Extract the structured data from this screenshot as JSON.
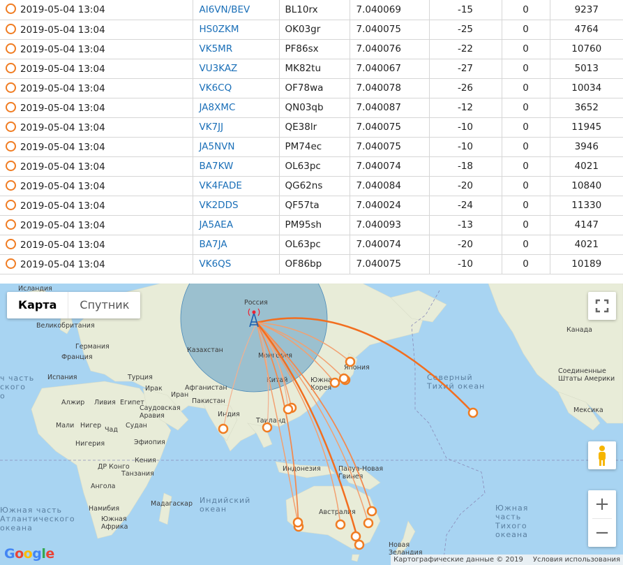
{
  "spots": [
    {
      "time": "2019-05-04 13:04",
      "call": "AI6VN/BEV",
      "grid": "BL10rx",
      "freq": "7.040069",
      "snr": "-15",
      "drift": "0",
      "dist": "9237"
    },
    {
      "time": "2019-05-04 13:04",
      "call": "HS0ZKM",
      "grid": "OK03gr",
      "freq": "7.040075",
      "snr": "-25",
      "drift": "0",
      "dist": "4764"
    },
    {
      "time": "2019-05-04 13:04",
      "call": "VK5MR",
      "grid": "PF86sx",
      "freq": "7.040076",
      "snr": "-22",
      "drift": "0",
      "dist": "10760"
    },
    {
      "time": "2019-05-04 13:04",
      "call": "VU3KAZ",
      "grid": "MK82tu",
      "freq": "7.040067",
      "snr": "-27",
      "drift": "0",
      "dist": "5013"
    },
    {
      "time": "2019-05-04 13:04",
      "call": "VK6CQ",
      "grid": "OF78wa",
      "freq": "7.040078",
      "snr": "-26",
      "drift": "0",
      "dist": "10034"
    },
    {
      "time": "2019-05-04 13:04",
      "call": "JA8XMC",
      "grid": "QN03qb",
      "freq": "7.040087",
      "snr": "-12",
      "drift": "0",
      "dist": "3652"
    },
    {
      "time": "2019-05-04 13:04",
      "call": "VK7JJ",
      "grid": "QE38lr",
      "freq": "7.040075",
      "snr": "-10",
      "drift": "0",
      "dist": "11945"
    },
    {
      "time": "2019-05-04 13:04",
      "call": "JA5NVN",
      "grid": "PM74ec",
      "freq": "7.040075",
      "snr": "-10",
      "drift": "0",
      "dist": "3946"
    },
    {
      "time": "2019-05-04 13:04",
      "call": "BA7KW",
      "grid": "OL63pc",
      "freq": "7.040074",
      "snr": "-18",
      "drift": "0",
      "dist": "4021"
    },
    {
      "time": "2019-05-04 13:04",
      "call": "VK4FADE",
      "grid": "QG62ns",
      "freq": "7.040084",
      "snr": "-20",
      "drift": "0",
      "dist": "10840"
    },
    {
      "time": "2019-05-04 13:04",
      "call": "VK2DDS",
      "grid": "QF57ta",
      "freq": "7.040024",
      "snr": "-24",
      "drift": "0",
      "dist": "11330"
    },
    {
      "time": "2019-05-04 13:04",
      "call": "JA5AEA",
      "grid": "PM95sh",
      "freq": "7.040093",
      "snr": "-13",
      "drift": "0",
      "dist": "4147"
    },
    {
      "time": "2019-05-04 13:04",
      "call": "BA7JA",
      "grid": "OL63pc",
      "freq": "7.040074",
      "snr": "-20",
      "drift": "0",
      "dist": "4021"
    },
    {
      "time": "2019-05-04 13:04",
      "call": "VK6QS",
      "grid": "OF86bp",
      "freq": "7.040075",
      "snr": "-10",
      "drift": "0",
      "dist": "10189"
    }
  ],
  "map": {
    "maptype": {
      "map": "Карта",
      "satellite": "Спутник"
    },
    "zoom": {
      "in": "+",
      "out": "−"
    },
    "google": "Google",
    "attribution": {
      "data": "Картографические данные © 2019",
      "terms": "Условия использования"
    },
    "labels": {
      "iceland": "Исландия",
      "russia": "Россия",
      "uk": "Великобритания",
      "germany": "Германия",
      "france": "Франция",
      "spain": "Испания",
      "turkey": "Турция",
      "iraq": "Ирак",
      "iran": "Иран",
      "kazakhstan": "Казахстан",
      "mongolia": "Монголия",
      "china": "Китай",
      "afghanistan": "Афганистан",
      "pakistan": "Пакистан",
      "india": "Индия",
      "thailand": "Таиланд",
      "south_korea": "Южная\nКорея",
      "japan": "Япония",
      "algeria": "Алжир",
      "libya": "Ливия",
      "egypt": "Египет",
      "saudi": "Саудовская\nАравия",
      "mali": "Мали",
      "niger": "Нигер",
      "chad": "Чад",
      "sudan": "Судан",
      "ethiopia": "Эфиопия",
      "nigeria": "Нигерия",
      "kenya": "Кения",
      "drc": "ДР Конго",
      "tanzania": "Танзания",
      "angola": "Ангола",
      "namibia": "Намибия",
      "south_africa": "Южная\nАфрика",
      "madagascar": "Мадагаскар",
      "indonesia": "Индонезия",
      "png": "Папуа-Новая\nГвинея",
      "australia": "Австралия",
      "nz": "Новая\nЗеландия",
      "canada": "Канада",
      "usa": "Соединенные\nШтаты Америки",
      "mexico": "Мексика",
      "indian_ocean": "Индийский\nокеан",
      "n_pacific": "Северный\nТихий океан",
      "s_pacific": "Южная\nчасть\nТихого\nокеана",
      "s_atlantic": "Южная часть\nАтлантического\nокеана",
      "n_atlantic": "ч часть\nского\nо"
    }
  }
}
